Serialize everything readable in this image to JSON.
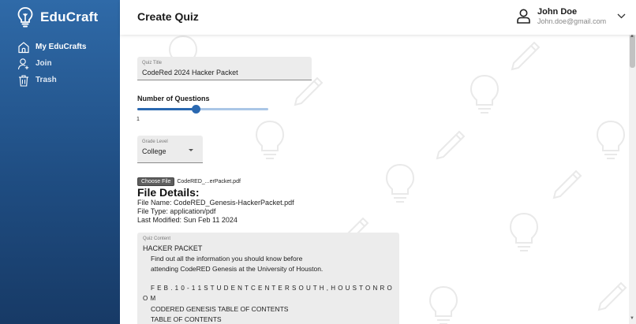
{
  "brand": {
    "name": "EduCraft",
    "icon": "lightbulb-icon"
  },
  "sidebar": {
    "items": [
      {
        "label": "My EduCrafts",
        "icon": "home-icon"
      },
      {
        "label": "Join",
        "icon": "user-add-icon"
      },
      {
        "label": "Trash",
        "icon": "trash-icon"
      }
    ]
  },
  "header": {
    "title": "Create Quiz",
    "user": {
      "name": "John Doe",
      "email": "John.doe@gmail.com",
      "icon": "user-icon",
      "menu_icon": "chevron-down-icon"
    }
  },
  "form": {
    "quiz_title": {
      "label": "Quiz Title",
      "value": "CodeRed 2024 Hacker Packet"
    },
    "questions": {
      "label": "Number of Questions",
      "value": "1",
      "fraction": 0.45
    },
    "grade": {
      "label": "Grade Level",
      "value": "College"
    },
    "file": {
      "button": "Choose File",
      "name": "CodeRED_...erPacket.pdf"
    },
    "details": {
      "title": "File Details:",
      "name": "File Name: CodeRED_Genesis-HackerPacket.pdf",
      "type": "File Type: application/pdf",
      "modified": "Last Modified: Sun Feb 11 2024"
    },
    "content": {
      "label": "Quiz Content",
      "lines": [
        "HACKER PACKET",
        "Find out all the information you should know before",
        "attending CodeRED Genesis at the University of Houston.",
        "F E B . 1 0 - 1 1 S T U D E N T C E N T E R S O U T H , H O U S T O N R O",
        "O M",
        "CODERED GENESIS TABLE OF CONTENTS",
        "TABLE OF CONTENTS"
      ]
    }
  },
  "colors": {
    "accent": "#2a68b0",
    "sidebar": "#1f4d82"
  }
}
